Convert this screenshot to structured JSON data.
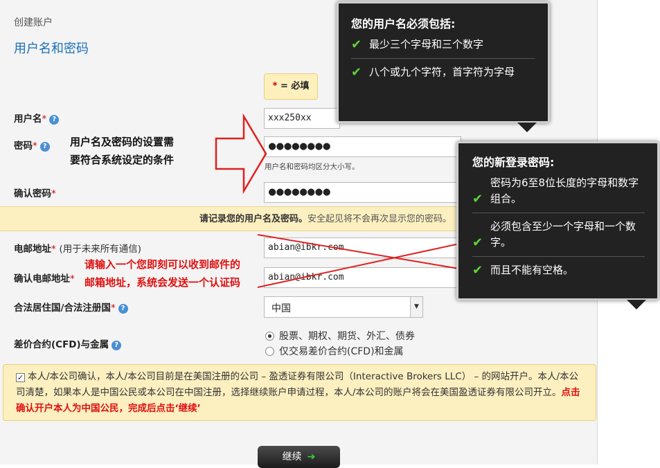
{
  "breadcrumb": "创建账户",
  "section_title": "用户名和密码",
  "legend": {
    "star": "*",
    "text": "= 必填"
  },
  "fields": {
    "username": {
      "label": "用户名",
      "value": "xxx250xx"
    },
    "password": {
      "label": "密码",
      "value": "●●●●●●●●",
      "hint": "用户名和密码均区分大小写。"
    },
    "confirm_password": {
      "label": "确认密码",
      "value": "●●●●●●●●"
    },
    "email": {
      "label": "电邮地址",
      "note": "(用于未来所有通信)",
      "value": "abian@ibkr.com"
    },
    "confirm_email": {
      "label": "确认电邮地址",
      "value": "abian@ibkr.com"
    },
    "residence": {
      "label": "合法居住国/合法注册国",
      "value": "中国"
    },
    "cfd": {
      "label": "差价合约(CFD)与金属",
      "options": [
        "股票、期权、期货、外汇、债券",
        "仅交易差价合约(CFD)和金属"
      ],
      "selected": 0
    }
  },
  "required_mark": "*",
  "notice": {
    "bold": "请记录您的用户名及密码。",
    "rest": "安全起见将不会再次显示您的密码。"
  },
  "confirm": {
    "checked": true,
    "text": "本人/本公司确认，本人/本公司目前是在美国注册的公司 – 盈透证券有限公司（Interactive Brokers LLC） – 的网站开户。本人/本公司清楚，如果本人是中国公民或本公司在中国注册，选择继续账户申请过程，本人/本公司的账户将会在美国盈透证券有限公司开立。",
    "annotation": "点击确认开户本人为中国公民，完成后点击‘继续’"
  },
  "continue_label": "继续",
  "tooltip_username": {
    "title": "您的用户名必须包括:",
    "items": [
      "最少三个字母和三个数字",
      "八个或九个字符，首字符为字母"
    ]
  },
  "tooltip_password": {
    "title": "您的新登录密码:",
    "items": [
      "密码为6至8位长度的字母和数字组合。",
      "必须包含至少一个字母和一个数字。",
      "而且不能有空格。"
    ]
  },
  "annotations": {
    "requirement": [
      "用户名及密码的设置需",
      "要符合系统设定的条件"
    ],
    "email": [
      "请输入一个您即刻可以收到邮件的",
      "邮箱地址，系统会发送一个认证码"
    ]
  },
  "colors": {
    "accent_blue": "#1a6fb7",
    "annotation_red": "#e01010",
    "highlight_yellow": "#fcefc0",
    "tooltip_bg": "#222222"
  }
}
